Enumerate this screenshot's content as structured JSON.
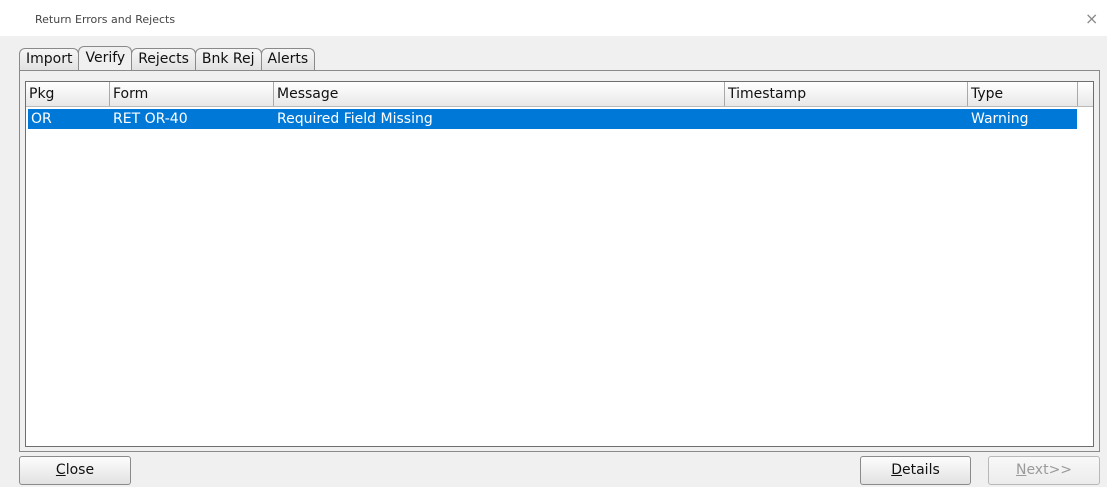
{
  "window": {
    "title": "Return Errors and Rejects",
    "close_glyph": "×"
  },
  "tabs": [
    {
      "label": "Import",
      "active": false
    },
    {
      "label": "Verify",
      "active": true
    },
    {
      "label": "Rejects",
      "active": false
    },
    {
      "label": "Bnk Rej",
      "active": false
    },
    {
      "label": "Alerts",
      "active": false
    }
  ],
  "table": {
    "columns": [
      "Pkg",
      "Form",
      "Message",
      "Timestamp",
      "Type"
    ],
    "rows": [
      {
        "pkg": "OR",
        "form": "RET OR-40",
        "message": "Required Field Missing",
        "timestamp": "",
        "type": "Warning",
        "selected": true
      }
    ]
  },
  "buttons": {
    "close": {
      "accel": "C",
      "rest": "lose"
    },
    "details": {
      "accel": "D",
      "rest": "etails"
    },
    "next": {
      "accel": "N",
      "rest": "ext>>",
      "enabled": false
    }
  },
  "colors": {
    "selection": "#0078d7",
    "background": "#f0f0f0"
  }
}
